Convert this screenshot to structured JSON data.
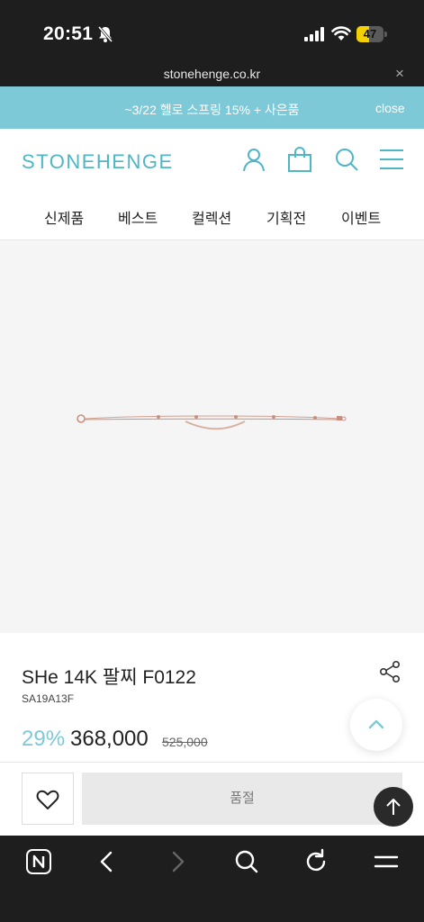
{
  "status_bar": {
    "time": "20:51",
    "battery": "47",
    "battery_level": 0.47
  },
  "browser": {
    "url": "stonehenge.co.kr",
    "close_glyph": "×"
  },
  "promo": {
    "text": "~3/22 헬로 스프링 15% + 사은품",
    "close_label": "close"
  },
  "header": {
    "logo": "STONEHENGE"
  },
  "nav": {
    "items": [
      "신제품",
      "베스트",
      "컬렉션",
      "기획전",
      "이벤트"
    ]
  },
  "product": {
    "title": "SHe 14K 팔찌 F0122",
    "sku": "SA19A13F",
    "discount": "29%",
    "price": "368,000",
    "original_price": "525,000"
  },
  "actions": {
    "soldout_label": "품절"
  },
  "colors": {
    "accent": "#7ec9d8",
    "logo": "#4fb6c6",
    "battery": "#f5d000"
  },
  "icons": {
    "header": [
      "user-icon",
      "bag-icon",
      "search-icon",
      "menu-icon"
    ],
    "toolbar": [
      "naver-n-icon",
      "back-icon",
      "forward-icon",
      "search-icon",
      "reload-icon",
      "menu-icon"
    ]
  }
}
